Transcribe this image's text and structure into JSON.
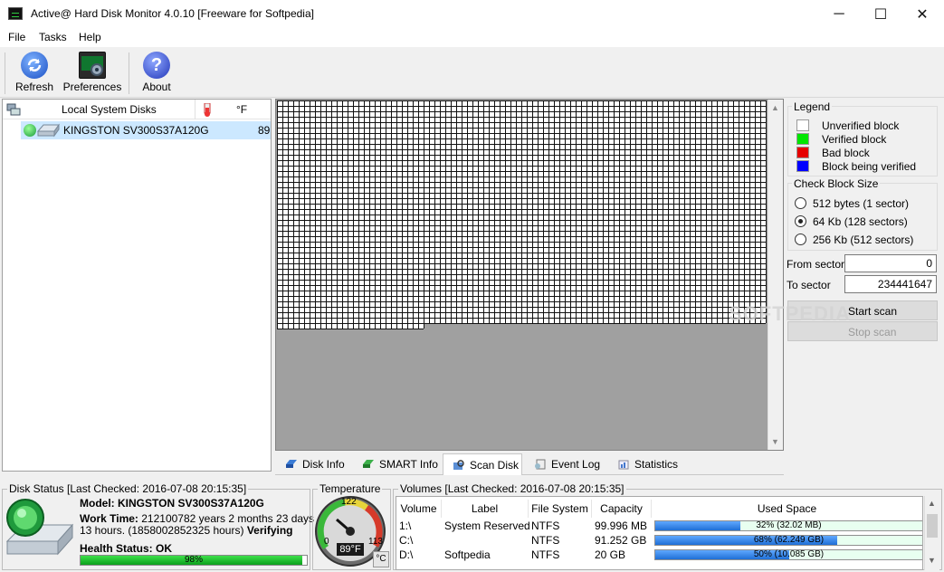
{
  "window": {
    "title": "Active@ Hard Disk Monitor 4.0.10 [Freeware for Softpedia]",
    "minimize": "─",
    "maximize": "☐",
    "close": "✕"
  },
  "menu": [
    "File",
    "Tasks",
    "Help"
  ],
  "toolbar": {
    "refresh": "Refresh",
    "preferences": "Preferences",
    "about": "About"
  },
  "tree": {
    "header": "Local System Disks",
    "unit": "°F",
    "disk_name": "KINGSTON SV300S37A120G",
    "disk_temp": "89"
  },
  "scan_map": {
    "verified_fraction_note": "grid partially drawn",
    "full_rows": 41,
    "partial_row_cells": 27
  },
  "legend": {
    "title": "Legend",
    "items": [
      {
        "label": "Unverified block",
        "color": "#ffffff"
      },
      {
        "label": "Verified block",
        "color": "#00e600"
      },
      {
        "label": "Bad block",
        "color": "#e60000"
      },
      {
        "label": "Block being verified",
        "color": "#0000ff"
      }
    ]
  },
  "block_size": {
    "title": "Check Block Size",
    "options": [
      {
        "label": "512 bytes (1 sector)",
        "selected": false
      },
      {
        "label": "64 Kb (128 sectors)",
        "selected": true
      },
      {
        "label": "256 Kb (512 sectors)",
        "selected": false
      }
    ]
  },
  "range": {
    "from_label": "From sector",
    "from_value": "0",
    "to_label": "To sector",
    "to_value": "234441647"
  },
  "buttons": {
    "start_scan": "Start scan",
    "stop_scan": "Stop scan"
  },
  "watermark": "SOFTPEDIA",
  "tabs": [
    "Disk Info",
    "SMART Info",
    "Scan Disk",
    "Event Log",
    "Statistics"
  ],
  "active_tab": "Scan Disk",
  "disk_status": {
    "title": "Disk Status [Last Checked: 2016-07-08 20:15:35]",
    "model_label": "Model:",
    "model_value": "KINGSTON SV300S37A120G",
    "work_time_label": "Work Time:",
    "work_time_value": "212100782 years 2 months 23 days",
    "work_time_line2": "13 hours. (1858002852325 hours)",
    "verifying": "Verifying",
    "health_label": "Health Status:",
    "health_value": "OK",
    "health_percent": "98%",
    "health_fraction": 0.98
  },
  "temperature": {
    "title": "Temperature",
    "gauge_top": "122",
    "gauge_left": "0",
    "gauge_right": "113",
    "reading": "89°F",
    "unit_button": "°C"
  },
  "volumes": {
    "title": "Volumes [Last Checked: 2016-07-08 20:15:35]",
    "headers": [
      "Volume",
      "Label",
      "File System",
      "Capacity",
      "Used Space"
    ],
    "rows": [
      {
        "volume": "1:\\",
        "label": "System Reserved",
        "fs": "NTFS",
        "capacity": "99.996 MB",
        "used_text": "32% (32.02 MB)",
        "used": 0.32
      },
      {
        "volume": "C:\\",
        "label": "",
        "fs": "NTFS",
        "capacity": "91.252 GB",
        "used_text": "68% (62.249 GB)",
        "used": 0.68
      },
      {
        "volume": "D:\\",
        "label": "Softpedia",
        "fs": "NTFS",
        "capacity": "20 GB",
        "used_text": "50% (10.085 GB)",
        "used": 0.5
      }
    ]
  }
}
